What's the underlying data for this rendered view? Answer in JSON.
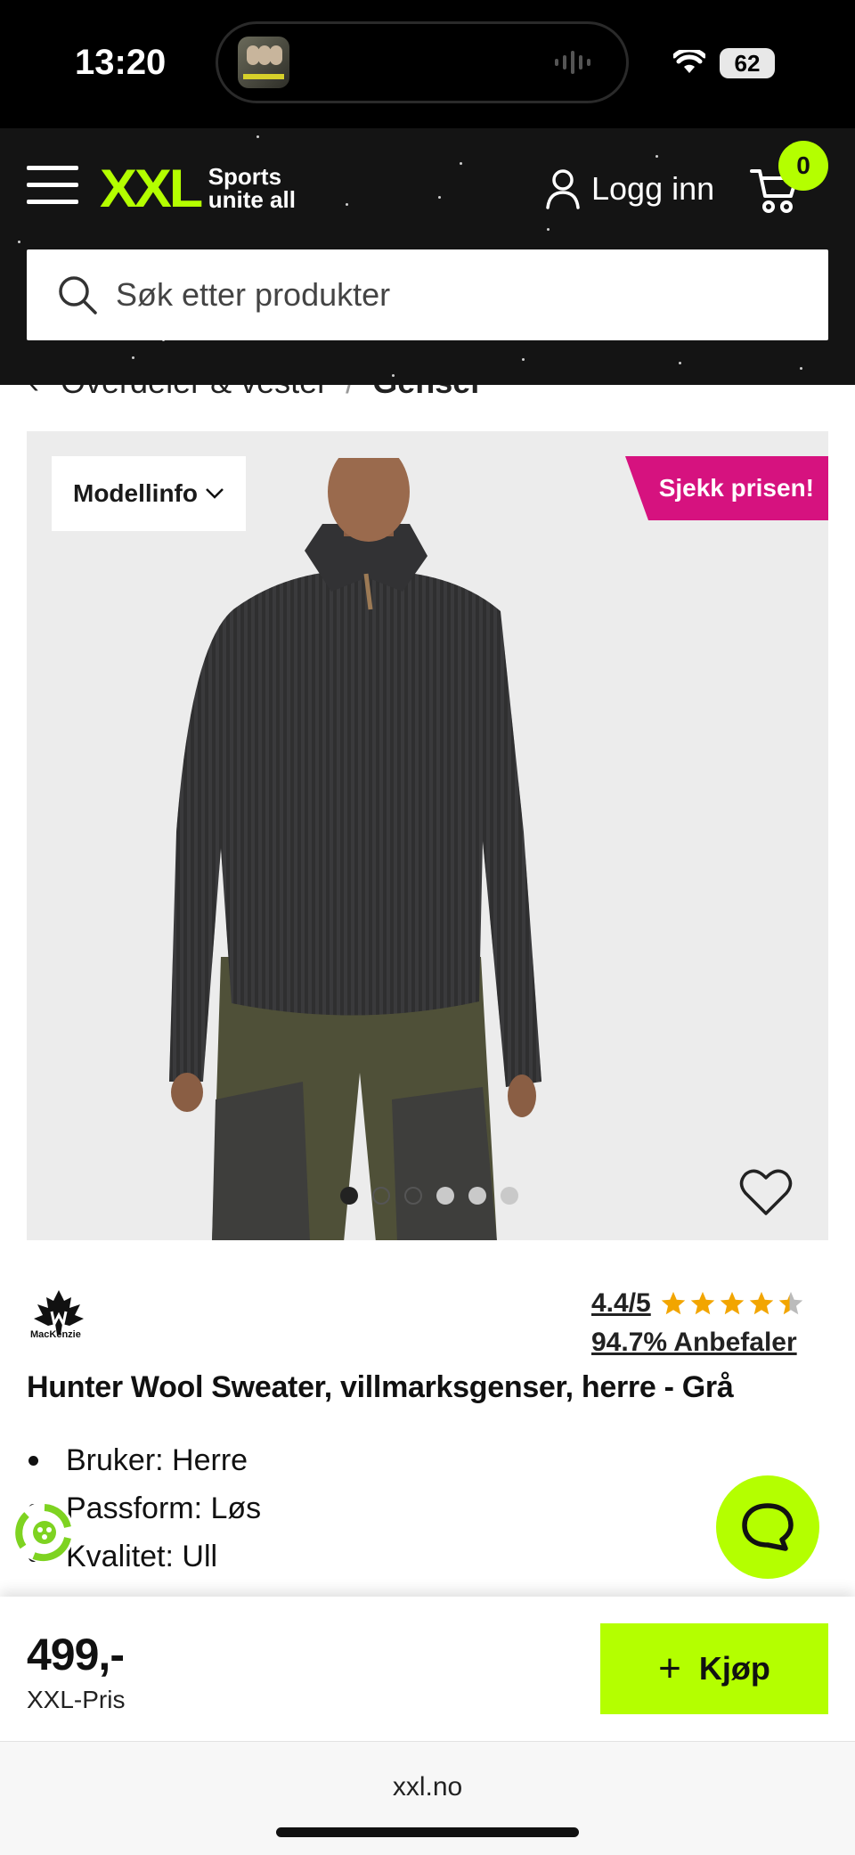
{
  "status_bar": {
    "time": "13:20",
    "battery": "62"
  },
  "header": {
    "logo_text": "XXL",
    "logo_tagline_1": "Sports",
    "logo_tagline_2": "unite all",
    "login_label": "Logg inn",
    "cart_count": "0",
    "accent_color": "#b4ff00"
  },
  "search": {
    "placeholder": "Søk etter produkter"
  },
  "breadcrumb": {
    "parent": "Overdeler & vester",
    "separator": "/",
    "current": "Genser"
  },
  "gallery": {
    "model_info_label": "Modellinfo",
    "price_ribbon": "Sjekk prisen!",
    "ribbon_color": "#d6127f",
    "image_count": 6,
    "active_index": 0
  },
  "product": {
    "brand": "MacKenzie",
    "rating": "4.4/5",
    "rating_value": 4.4,
    "rating_max": 5,
    "recommend": "94.7% Anbefaler",
    "title": "Hunter Wool Sweater, villmarksgenser, herre - Grå",
    "features": [
      "Bruker: Herre",
      "Passform: Løs",
      "Kvalitet: Ull"
    ]
  },
  "buy_bar": {
    "price": "499,-",
    "price_label": "XXL-Pris",
    "buy_label": "Kjøp"
  },
  "browser": {
    "url": "xxl.no"
  },
  "icons": [
    "menu-icon",
    "user-icon",
    "cart-icon",
    "search-icon",
    "chevron-left-icon",
    "chevron-down-icon",
    "heart-icon",
    "star-icon",
    "recycle-icon",
    "chat-icon",
    "plus-icon",
    "wifi-icon"
  ]
}
